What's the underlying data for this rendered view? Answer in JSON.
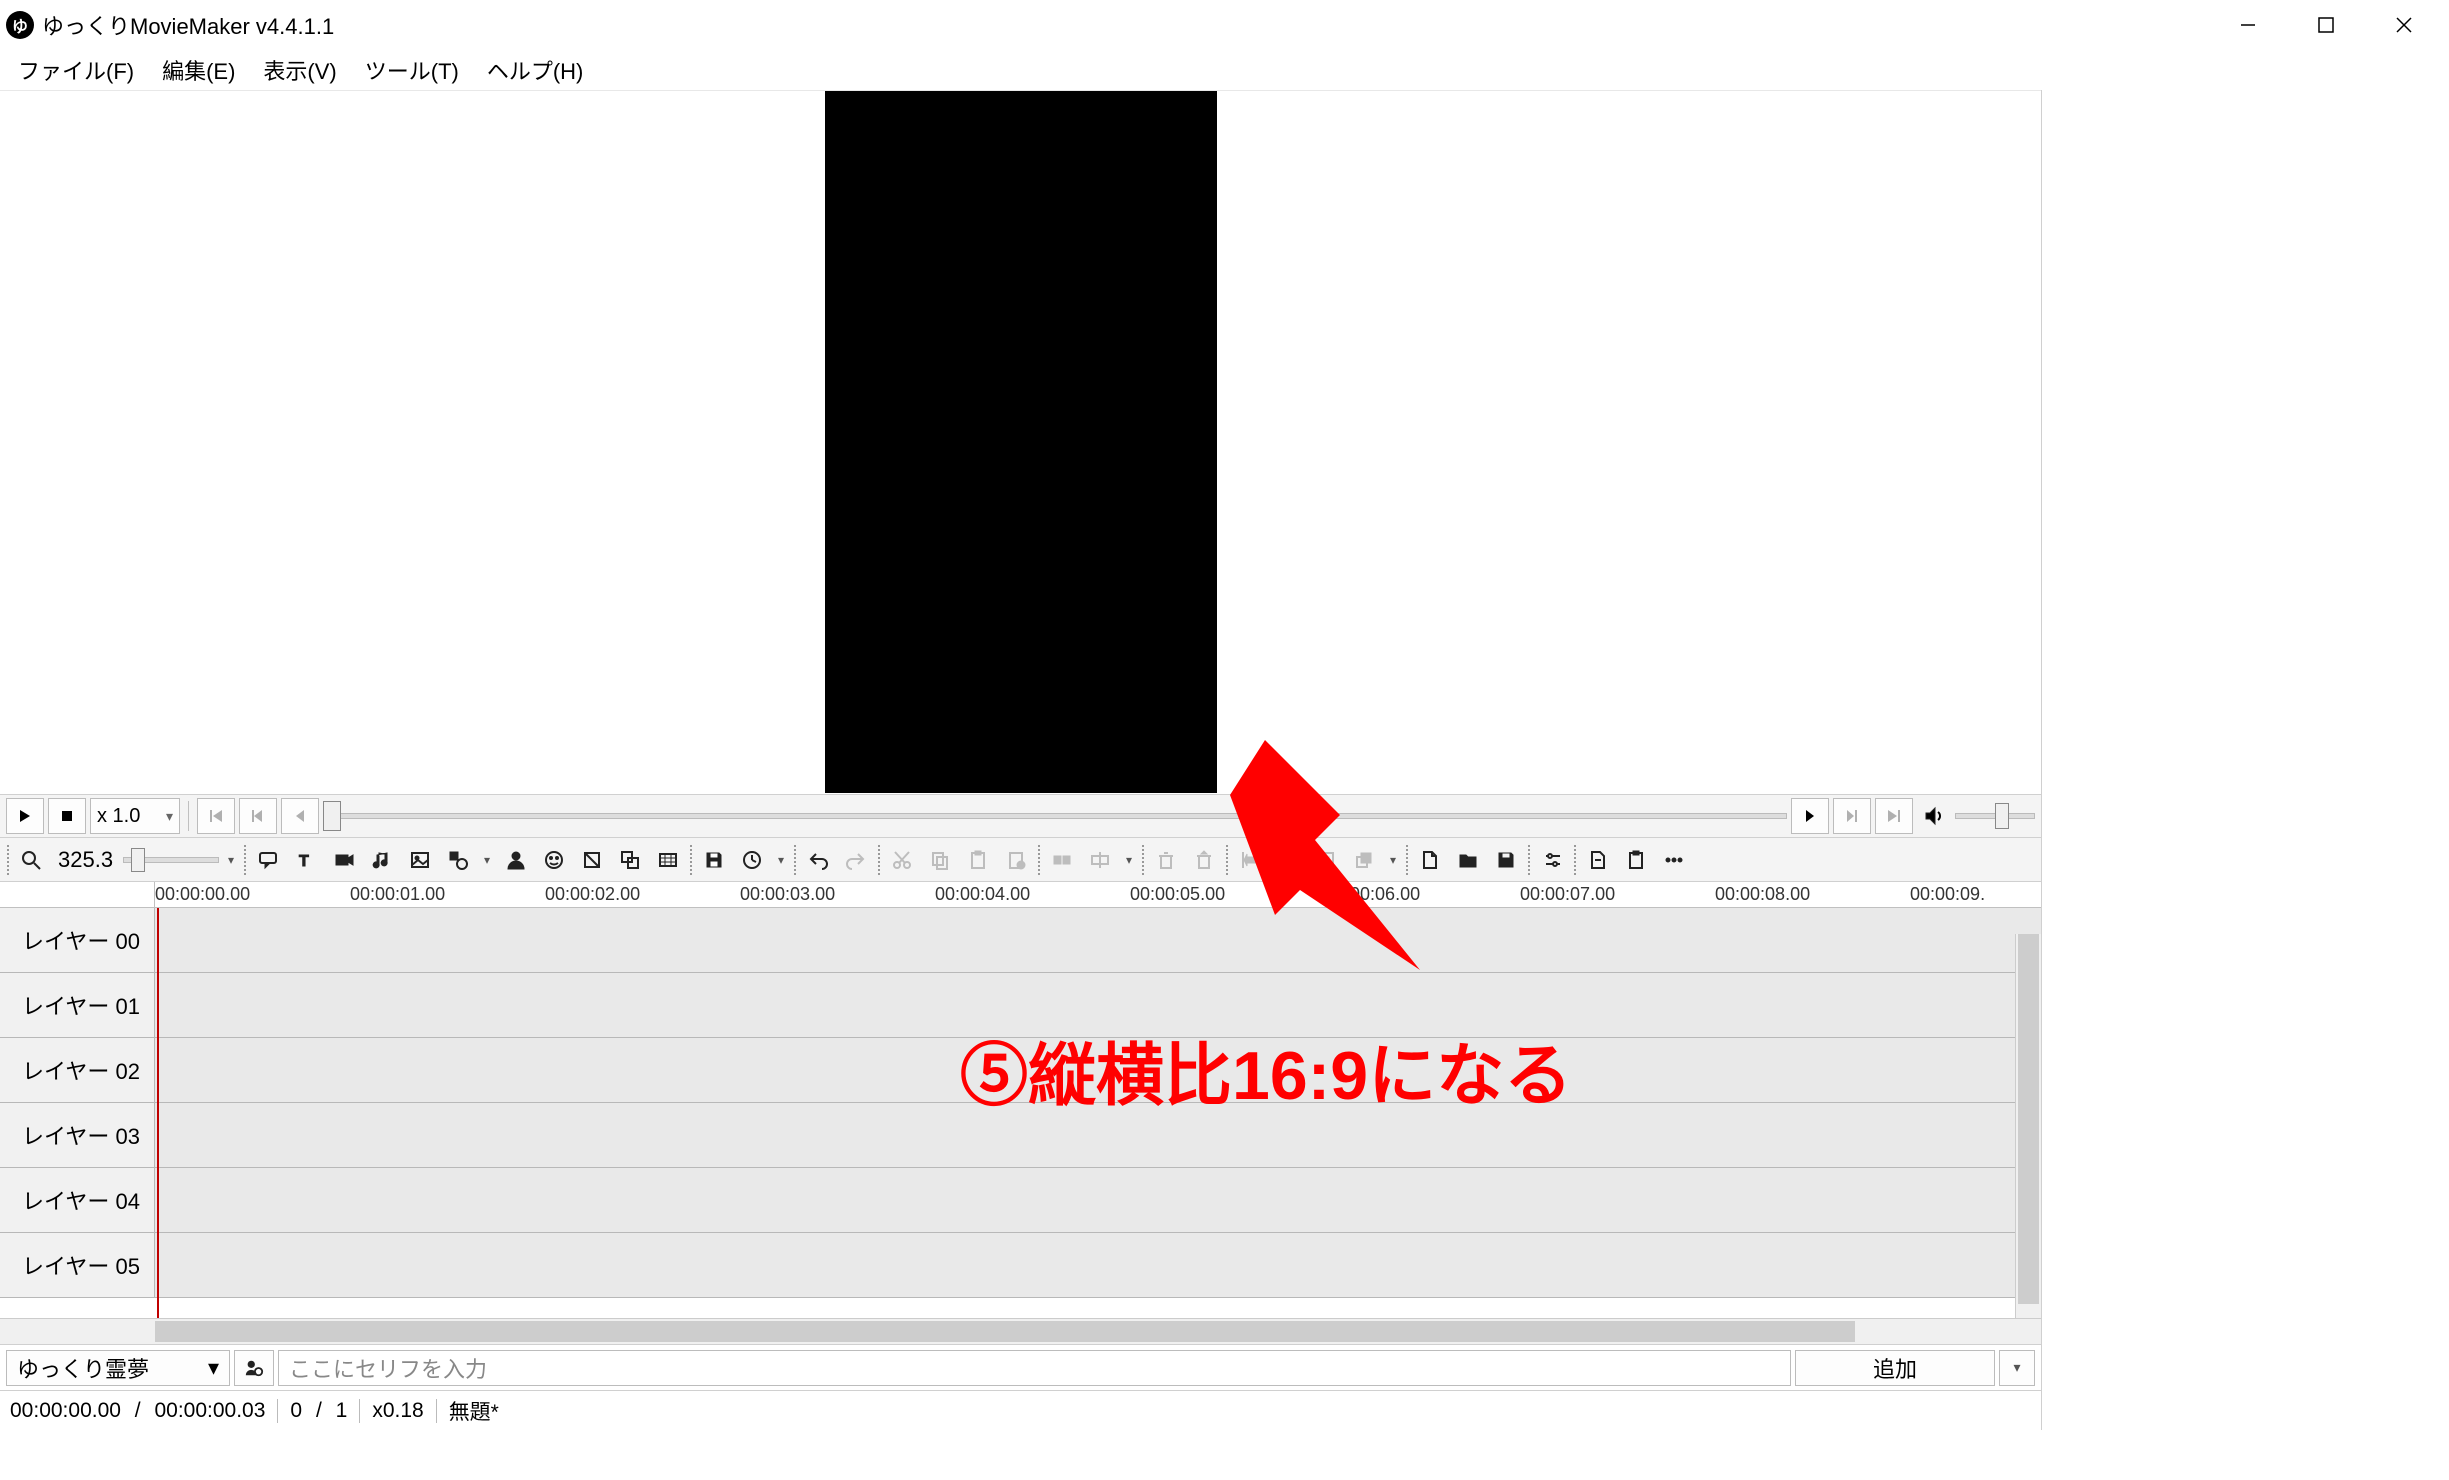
{
  "titlebar": {
    "app_icon_glyph": "ゆ",
    "title": "ゆっくりMovieMaker v4.4.1.1"
  },
  "menubar": {
    "file": "ファイル(F)",
    "edit": "編集(E)",
    "view": "表示(V)",
    "tools": "ツール(T)",
    "help": "ヘルプ(H)"
  },
  "playback": {
    "speed": "x 1.0"
  },
  "toolbar": {
    "zoom_value": "325.3"
  },
  "ruler": {
    "ticks": [
      {
        "label": "00:00:00.00",
        "pos": 0
      },
      {
        "label": "00:00:01.00",
        "pos": 195
      },
      {
        "label": "00:00:02.00",
        "pos": 390
      },
      {
        "label": "00:00:03.00",
        "pos": 585
      },
      {
        "label": "00:00:04.00",
        "pos": 780
      },
      {
        "label": "00:00:05.00",
        "pos": 975
      },
      {
        "label": "00:00:06.00",
        "pos": 1170
      },
      {
        "label": "00:00:07.00",
        "pos": 1365
      },
      {
        "label": "00:00:08.00",
        "pos": 1560
      },
      {
        "label": "00:00:09.",
        "pos": 1755
      }
    ]
  },
  "layers": [
    {
      "name": "レイヤー 00"
    },
    {
      "name": "レイヤー 01"
    },
    {
      "name": "レイヤー 02"
    },
    {
      "name": "レイヤー 03"
    },
    {
      "name": "レイヤー 04"
    },
    {
      "name": "レイヤー 05"
    }
  ],
  "inputrow": {
    "character": "ゆっくり霊夢",
    "placeholder": "ここにセリフを入力",
    "add_label": "追加"
  },
  "statusbar": {
    "current": "00:00:00.00",
    "sep1": "/",
    "total": "00:00:00.03",
    "frame_cur": "0",
    "sep2": "/",
    "frame_total": "1",
    "scale": "x0.18",
    "project": "無題*"
  },
  "annotation": {
    "text": "⑤縦横比16:9になる"
  }
}
